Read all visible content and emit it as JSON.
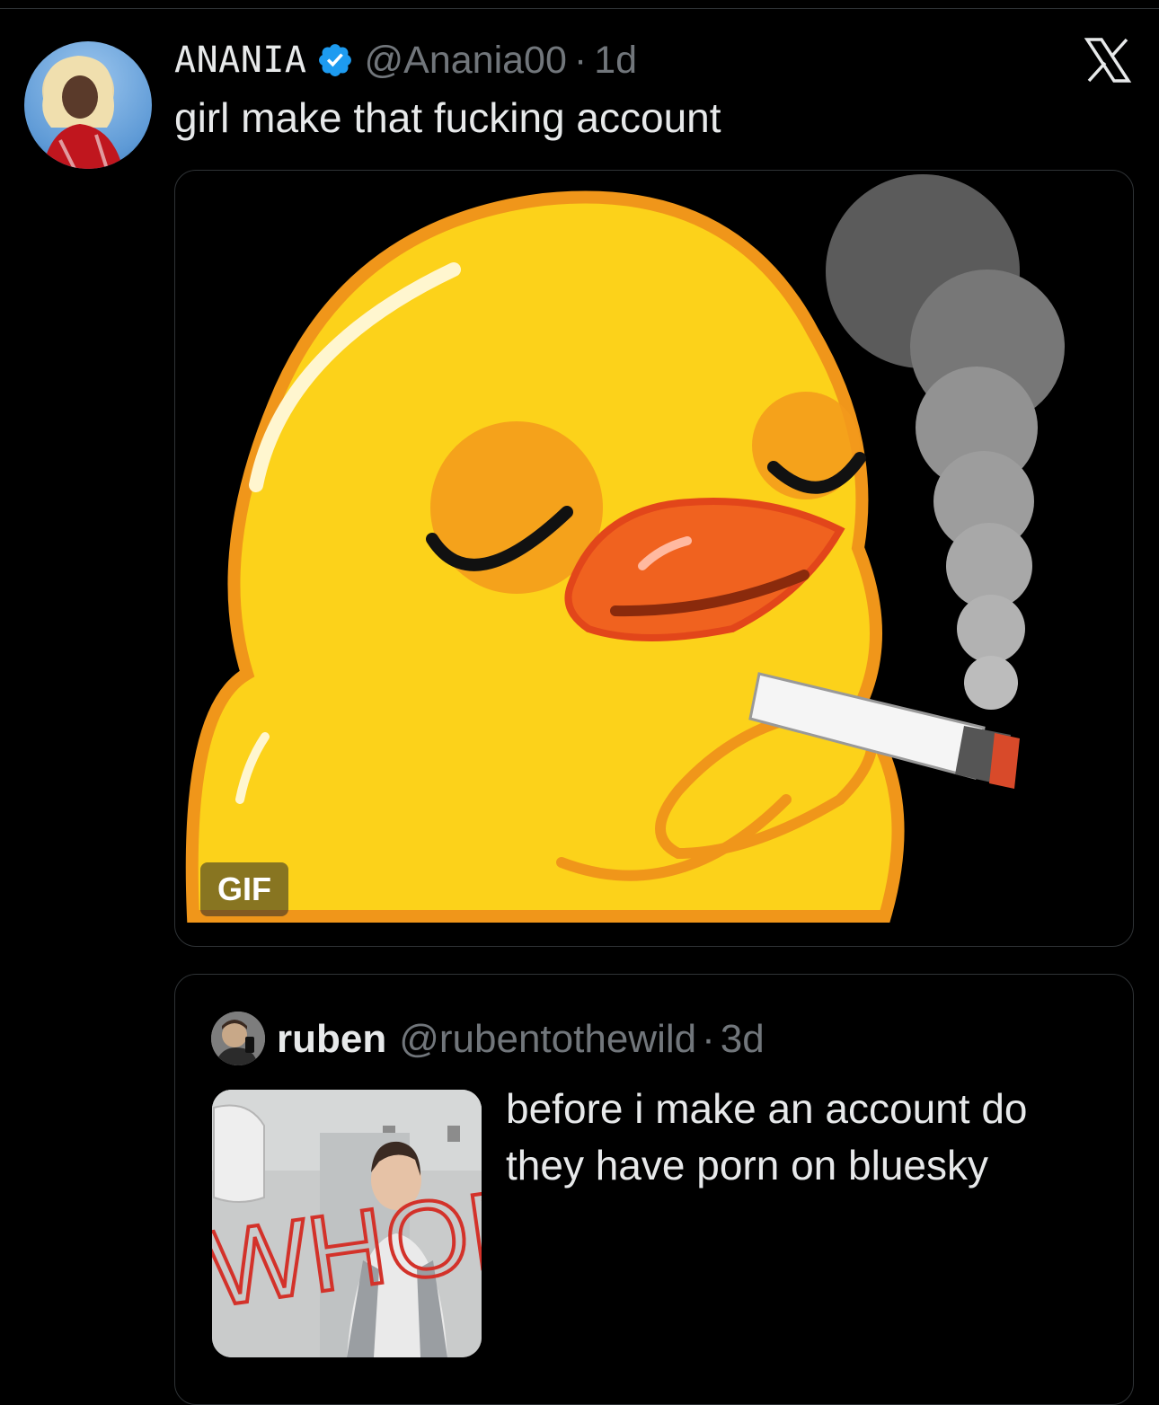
{
  "tweet": {
    "author": {
      "display_name": "ANANIA",
      "handle": "@Anania00",
      "verified": true,
      "avatar_icon": "profile-photo"
    },
    "separator": "·",
    "time": "1d",
    "text": "girl make that fucking account",
    "media": {
      "type": "gif",
      "badge": "GIF",
      "icon": "smoking-duck-gif"
    },
    "close_icon": "x-logo-icon"
  },
  "quoted_tweet": {
    "author": {
      "display_name": "ruben",
      "handle": "@rubentothewild",
      "avatar_icon": "profile-photo"
    },
    "separator": "·",
    "time": "3d",
    "text": "before i make an account do they have porn on bluesky",
    "thumbnail": {
      "icon": "bathroom-mirror-photo",
      "overlay_text": "WHORE"
    }
  },
  "colors": {
    "background": "#000000",
    "text_primary": "#e7e9ea",
    "text_secondary": "#71767b",
    "border": "#2f3336",
    "verified_blue": "#1d9bf0"
  }
}
